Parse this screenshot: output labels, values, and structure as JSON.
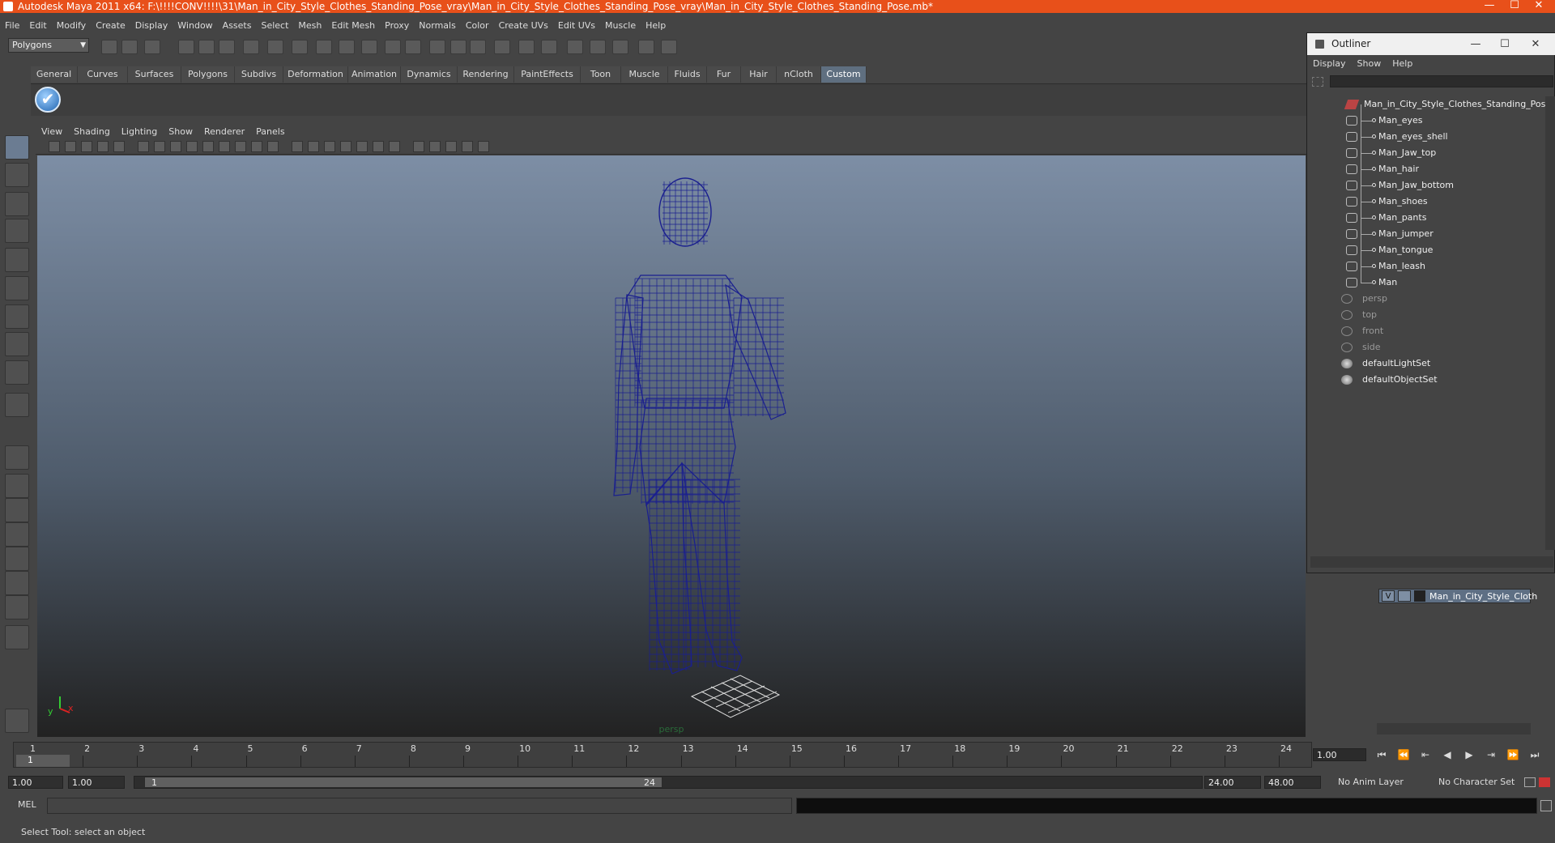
{
  "window": {
    "title": "Autodesk Maya 2011 x64: F:\\!!!!CONV!!!!\\31\\Man_in_City_Style_Clothes_Standing_Pose_vray\\Man_in_City_Style_Clothes_Standing_Pose_vray\\Man_in_City_Style_Clothes_Standing_Pose.mb*",
    "minimize": "—",
    "maximize": "☐",
    "close": "✕"
  },
  "menubar": [
    "File",
    "Edit",
    "Modify",
    "Create",
    "Display",
    "Window",
    "Assets",
    "Select",
    "Mesh",
    "Edit Mesh",
    "Proxy",
    "Normals",
    "Color",
    "Create UVs",
    "Edit UVs",
    "Muscle",
    "Help"
  ],
  "mode_select": "Polygons",
  "shelf_tabs": [
    {
      "label": "General",
      "active": false
    },
    {
      "label": "Curves",
      "active": false
    },
    {
      "label": "Surfaces",
      "active": false
    },
    {
      "label": "Polygons",
      "active": false
    },
    {
      "label": "Subdivs",
      "active": false
    },
    {
      "label": "Deformation",
      "active": false
    },
    {
      "label": "Animation",
      "active": false
    },
    {
      "label": "Dynamics",
      "active": false
    },
    {
      "label": "Rendering",
      "active": false
    },
    {
      "label": "PaintEffects",
      "active": false
    },
    {
      "label": "Toon",
      "active": false
    },
    {
      "label": "Muscle",
      "active": false
    },
    {
      "label": "Fluids",
      "active": false
    },
    {
      "label": "Fur",
      "active": false
    },
    {
      "label": "Hair",
      "active": false
    },
    {
      "label": "nCloth",
      "active": false
    },
    {
      "label": "Custom",
      "active": true
    }
  ],
  "shelf_check_glyph": "✔",
  "panel_menu": [
    "View",
    "Shading",
    "Lighting",
    "Show",
    "Renderer",
    "Panels"
  ],
  "viewport": {
    "camera_label": "persp",
    "wire_color": "#1a1f8f",
    "axis_x": "x",
    "axis_y": "y"
  },
  "outliner": {
    "title": "Outliner",
    "minimize": "—",
    "maximize": "☐",
    "close": "✕",
    "menu": [
      "Display",
      "Show",
      "Help"
    ],
    "collapse_glyph": "⊟",
    "items": [
      {
        "label": "Man_in_City_Style_Clothes_Standing_Pose",
        "indent": 0,
        "icon": "group-icon",
        "dim": false
      },
      {
        "label": "Man_eyes",
        "indent": 1,
        "icon": "mesh-icon",
        "dim": false
      },
      {
        "label": "Man_eyes_shell",
        "indent": 1,
        "icon": "mesh-icon",
        "dim": false
      },
      {
        "label": "Man_Jaw_top",
        "indent": 1,
        "icon": "mesh-icon",
        "dim": false
      },
      {
        "label": "Man_hair",
        "indent": 1,
        "icon": "mesh-icon",
        "dim": false
      },
      {
        "label": "Man_Jaw_bottom",
        "indent": 1,
        "icon": "mesh-icon",
        "dim": false
      },
      {
        "label": "Man_shoes",
        "indent": 1,
        "icon": "mesh-icon",
        "dim": false
      },
      {
        "label": "Man_pants",
        "indent": 1,
        "icon": "mesh-icon",
        "dim": false
      },
      {
        "label": "Man_jumper",
        "indent": 1,
        "icon": "mesh-icon",
        "dim": false
      },
      {
        "label": "Man_tongue",
        "indent": 1,
        "icon": "mesh-icon",
        "dim": false
      },
      {
        "label": "Man_leash",
        "indent": 1,
        "icon": "mesh-icon",
        "dim": false
      },
      {
        "label": "Man",
        "indent": 1,
        "icon": "mesh-icon",
        "dim": false
      },
      {
        "label": "persp",
        "indent": 0,
        "icon": "camera-icon",
        "dim": true
      },
      {
        "label": "top",
        "indent": 0,
        "icon": "camera-icon",
        "dim": true
      },
      {
        "label": "front",
        "indent": 0,
        "icon": "camera-icon",
        "dim": true
      },
      {
        "label": "side",
        "indent": 0,
        "icon": "camera-icon",
        "dim": true
      },
      {
        "label": "defaultLightSet",
        "indent": 0,
        "icon": "set-icon",
        "dim": false
      },
      {
        "label": "defaultObjectSet",
        "indent": 0,
        "icon": "set-icon",
        "dim": false
      }
    ]
  },
  "layer": {
    "visible": "V",
    "name": "Man_in_City_Style_Cloth"
  },
  "timeline": {
    "ticks": [
      "1",
      "2",
      "3",
      "4",
      "5",
      "6",
      "7",
      "8",
      "9",
      "10",
      "11",
      "12",
      "13",
      "14",
      "15",
      "16",
      "17",
      "18",
      "19",
      "20",
      "21",
      "22",
      "23",
      "24"
    ],
    "current_frame": "1",
    "time_field": "1.00"
  },
  "playback_glyphs": [
    "⏮",
    "⏪",
    "⇤",
    "◀",
    "▶",
    "⇥",
    "⏩",
    "⏭"
  ],
  "range": {
    "start": "1.00",
    "playback_start": "1.00",
    "handle_start": "1",
    "handle_end": "24",
    "playback_end": "24.00",
    "end": "48.00",
    "anim_layer": "No Anim Layer",
    "character_set": "No Character Set"
  },
  "mel": {
    "label": "MEL"
  },
  "helpline": "Select Tool: select an object"
}
